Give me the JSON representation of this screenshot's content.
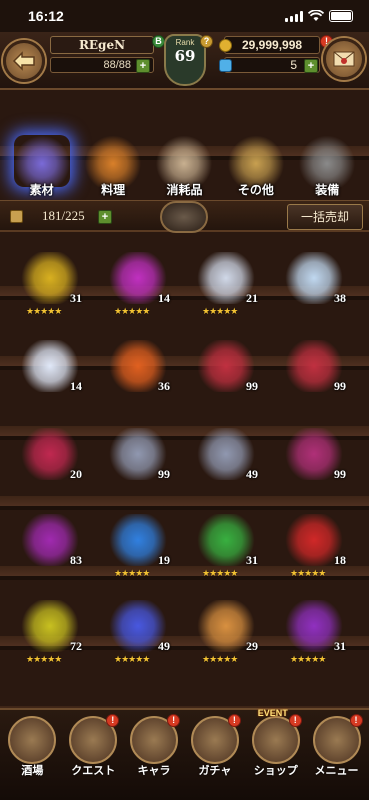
{
  "status": {
    "time": "16:12"
  },
  "header": {
    "player_name": "REgeN",
    "stamina": "88/88",
    "rank_label": "Rank",
    "rank_value": "69",
    "gold": "29,999,998",
    "gems": "5",
    "level_badge": "B",
    "help_badge": "?",
    "notice": "!"
  },
  "categories": [
    {
      "label": "素材",
      "color": "#7a6ad8",
      "icon": "material-icon",
      "active": true
    },
    {
      "label": "料理",
      "color": "#d9802a",
      "icon": "food-icon",
      "active": false
    },
    {
      "label": "消耗品",
      "color": "#c8b090",
      "icon": "consumable-icon",
      "active": false
    },
    {
      "label": "その他",
      "color": "#c8a050",
      "icon": "misc-icon",
      "active": false
    },
    {
      "label": "装備",
      "color": "#8a8a8a",
      "icon": "equipment-icon",
      "active": false
    }
  ],
  "inventory": {
    "count": "181/225",
    "bulk_sell_label": "一括売却"
  },
  "items": [
    {
      "qty": "31",
      "color": "#d8b020",
      "stars": "★★★★★",
      "icon": "gold-chalice-icon"
    },
    {
      "qty": "14",
      "color": "#c030c0",
      "stars": "★★★★★",
      "icon": "purple-chalice-icon"
    },
    {
      "qty": "21",
      "color": "#d0d8e8",
      "stars": "★★★★★",
      "icon": "potion-bottle-icon"
    },
    {
      "qty": "38",
      "color": "#c0d8f0",
      "stars": "",
      "icon": "silver-bar-icon"
    },
    {
      "qty": "14",
      "color": "#e0e8f8",
      "stars": "",
      "icon": "crystal-icon"
    },
    {
      "qty": "36",
      "color": "#e06020",
      "stars": "",
      "icon": "fire-stone-icon"
    },
    {
      "qty": "99",
      "color": "#c03040",
      "stars": "",
      "icon": "red-feather-icon"
    },
    {
      "qty": "99",
      "color": "#c03040",
      "stars": "",
      "icon": "red-feather-icon"
    },
    {
      "qty": "20",
      "color": "#c02850",
      "stars": "",
      "icon": "red-feather-icon"
    },
    {
      "qty": "99",
      "color": "#9098b0",
      "stars": "",
      "icon": "grey-wing-icon"
    },
    {
      "qty": "49",
      "color": "#9098b0",
      "stars": "",
      "icon": "grey-wing-icon"
    },
    {
      "qty": "99",
      "color": "#b03078",
      "stars": "",
      "icon": "horn-icon"
    },
    {
      "qty": "83",
      "color": "#a02ab0",
      "stars": "",
      "icon": "horn-icon"
    },
    {
      "qty": "19",
      "color": "#3080e0",
      "stars": "★★★★★",
      "icon": "blue-card-icon"
    },
    {
      "qty": "31",
      "color": "#38b040",
      "stars": "★★★★★",
      "icon": "green-card-icon"
    },
    {
      "qty": "18",
      "color": "#d02828",
      "stars": "★★★★★",
      "icon": "red-card-icon"
    },
    {
      "qty": "72",
      "color": "#c8c020",
      "stars": "★★★★★",
      "icon": "gold-statue-icon"
    },
    {
      "qty": "49",
      "color": "#4858e0",
      "stars": "★★★★★",
      "icon": "magic-orb-icon"
    },
    {
      "qty": "29",
      "color": "#d89040",
      "stars": "★★★★★",
      "icon": "amber-chalice-icon"
    },
    {
      "qty": "31",
      "color": "#9030c0",
      "stars": "★★★★★",
      "icon": "violet-chalice-icon"
    }
  ],
  "nav": [
    {
      "label": "酒場",
      "icon": "tavern-icon",
      "badge": ""
    },
    {
      "label": "クエスト",
      "icon": "quest-scroll-icon",
      "badge": "!"
    },
    {
      "label": "キャラ",
      "icon": "character-helmet-icon",
      "badge": "!"
    },
    {
      "label": "ガチャ",
      "icon": "gacha-icon",
      "badge": "!"
    },
    {
      "label": "ショップ",
      "icon": "shop-icon",
      "badge": "!",
      "tag": "EVENT"
    },
    {
      "label": "メニュー",
      "icon": "menu-gear-icon",
      "badge": "!"
    }
  ]
}
